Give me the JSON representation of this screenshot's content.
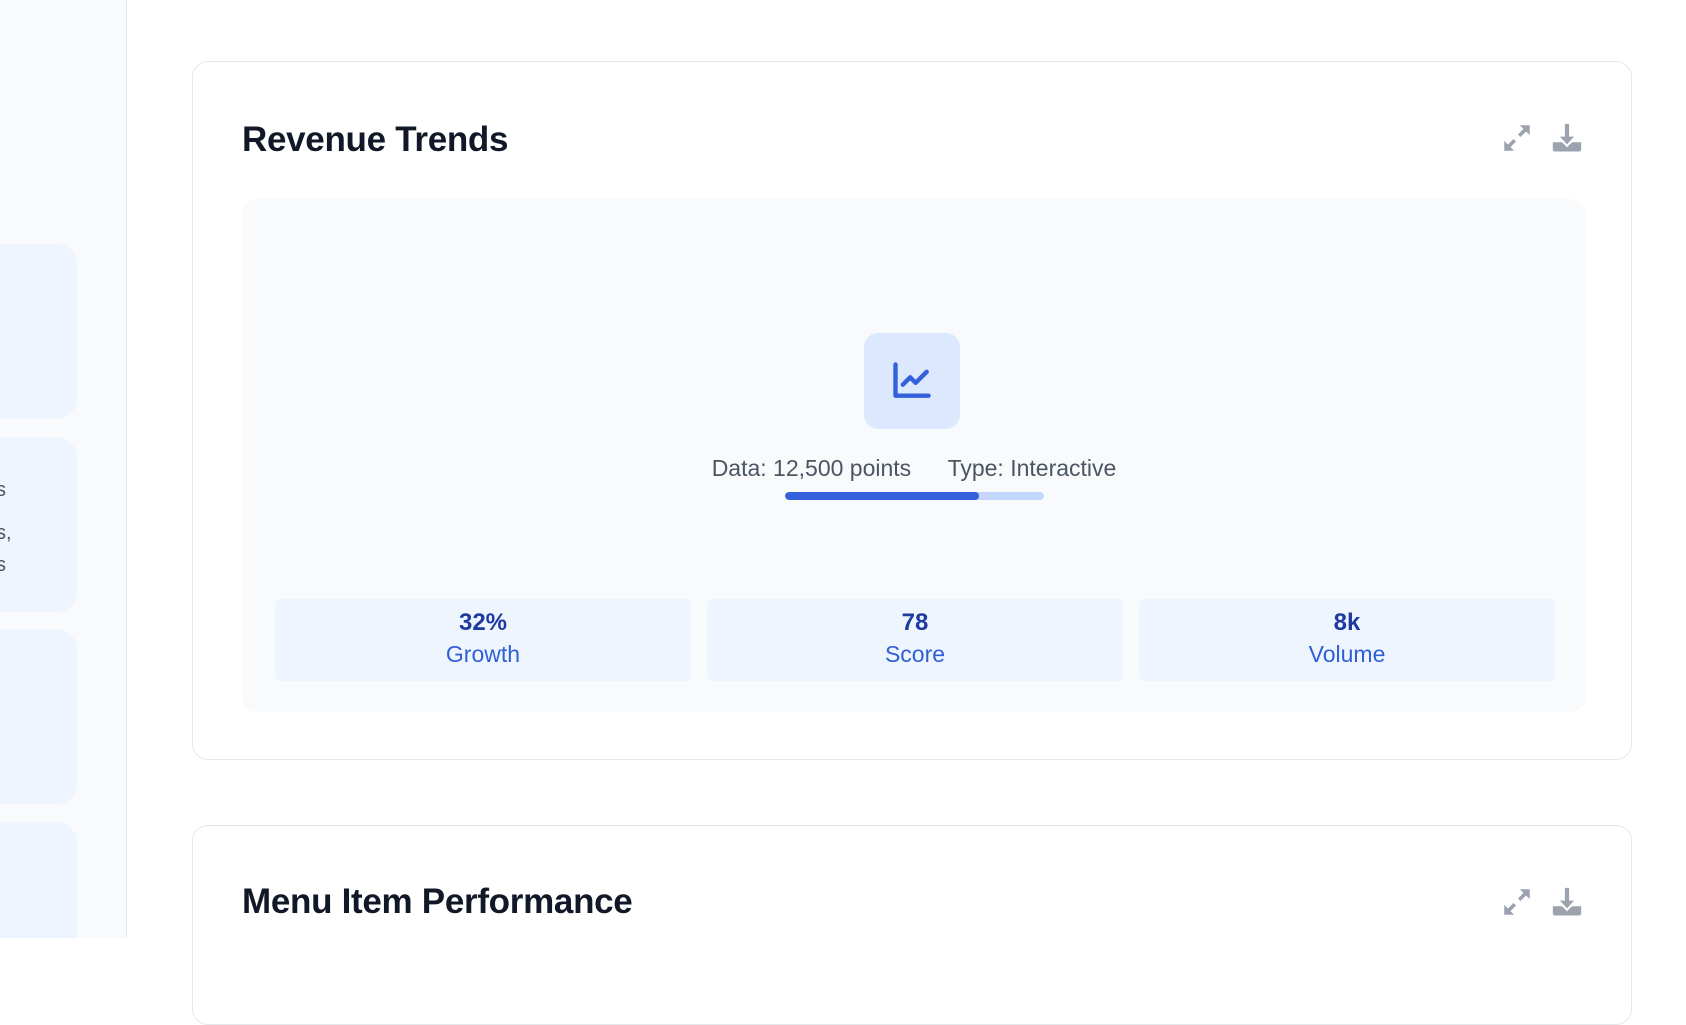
{
  "sidebar": {
    "snippets": [
      "s",
      "s,",
      "s"
    ]
  },
  "panels": [
    {
      "title": "Revenue Trends",
      "chart": {
        "icon": "line-chart-icon",
        "meta_data": "Data: 12,500 points",
        "meta_type": "Type: Interactive",
        "progress": 0.75
      },
      "stats": [
        {
          "value": "32%",
          "label": "Growth"
        },
        {
          "value": "78",
          "label": "Score"
        },
        {
          "value": "8k",
          "label": "Volume"
        }
      ]
    },
    {
      "title": "Menu Item Performance"
    }
  ],
  "icons": {
    "expand": "expand-icon",
    "download": "download-icon"
  },
  "colors": {
    "accent": "#3461db",
    "accent_light": "#c3d7fa",
    "icon_gray": "#9ca3af",
    "stat_bg": "#eef5ff"
  }
}
